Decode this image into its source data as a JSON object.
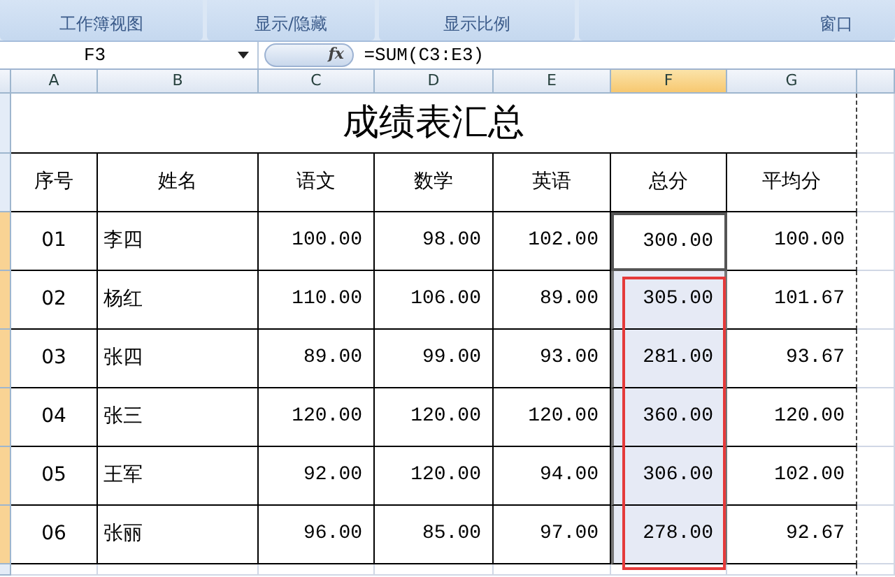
{
  "ribbon_groups": [
    "工作簿视图",
    "显示/隐藏",
    "显示比例",
    "窗口"
  ],
  "formula_bar": {
    "name_box": "F3",
    "fx": "fx",
    "formula": "=SUM(C3:E3)"
  },
  "columns": [
    {
      "label": "A",
      "selected": false
    },
    {
      "label": "B",
      "selected": false
    },
    {
      "label": "C",
      "selected": false
    },
    {
      "label": "D",
      "selected": false
    },
    {
      "label": "E",
      "selected": false
    },
    {
      "label": "F",
      "selected": true
    },
    {
      "label": "G",
      "selected": false
    }
  ],
  "sheet": {
    "title": "成绩表汇总",
    "headers": [
      "序号",
      "姓名",
      "语文",
      "数学",
      "英语",
      "总分",
      "平均分"
    ],
    "rows": [
      {
        "cells": [
          "01",
          "李四",
          "100.00",
          "98.00",
          "102.00",
          "300.00",
          "100.00"
        ],
        "selected": true,
        "active": true,
        "circled": false
      },
      {
        "cells": [
          "02",
          "杨红",
          "110.00",
          "106.00",
          "89.00",
          "305.00",
          "101.67"
        ],
        "selected": true,
        "active": false,
        "circled": true
      },
      {
        "cells": [
          "03",
          "张四",
          "89.00",
          "99.00",
          "93.00",
          "281.00",
          "93.67"
        ],
        "selected": true,
        "active": false,
        "circled": true
      },
      {
        "cells": [
          "04",
          "张三",
          "120.00",
          "120.00",
          "120.00",
          "360.00",
          "120.00"
        ],
        "selected": true,
        "active": false,
        "circled": true
      },
      {
        "cells": [
          "05",
          "王军",
          "92.00",
          "120.00",
          "94.00",
          "306.00",
          "102.00"
        ],
        "selected": true,
        "active": false,
        "circled": true
      },
      {
        "cells": [
          "06",
          "张丽",
          "96.00",
          "85.00",
          "97.00",
          "278.00",
          "92.67"
        ],
        "selected": true,
        "active": false,
        "circled": true
      }
    ]
  }
}
